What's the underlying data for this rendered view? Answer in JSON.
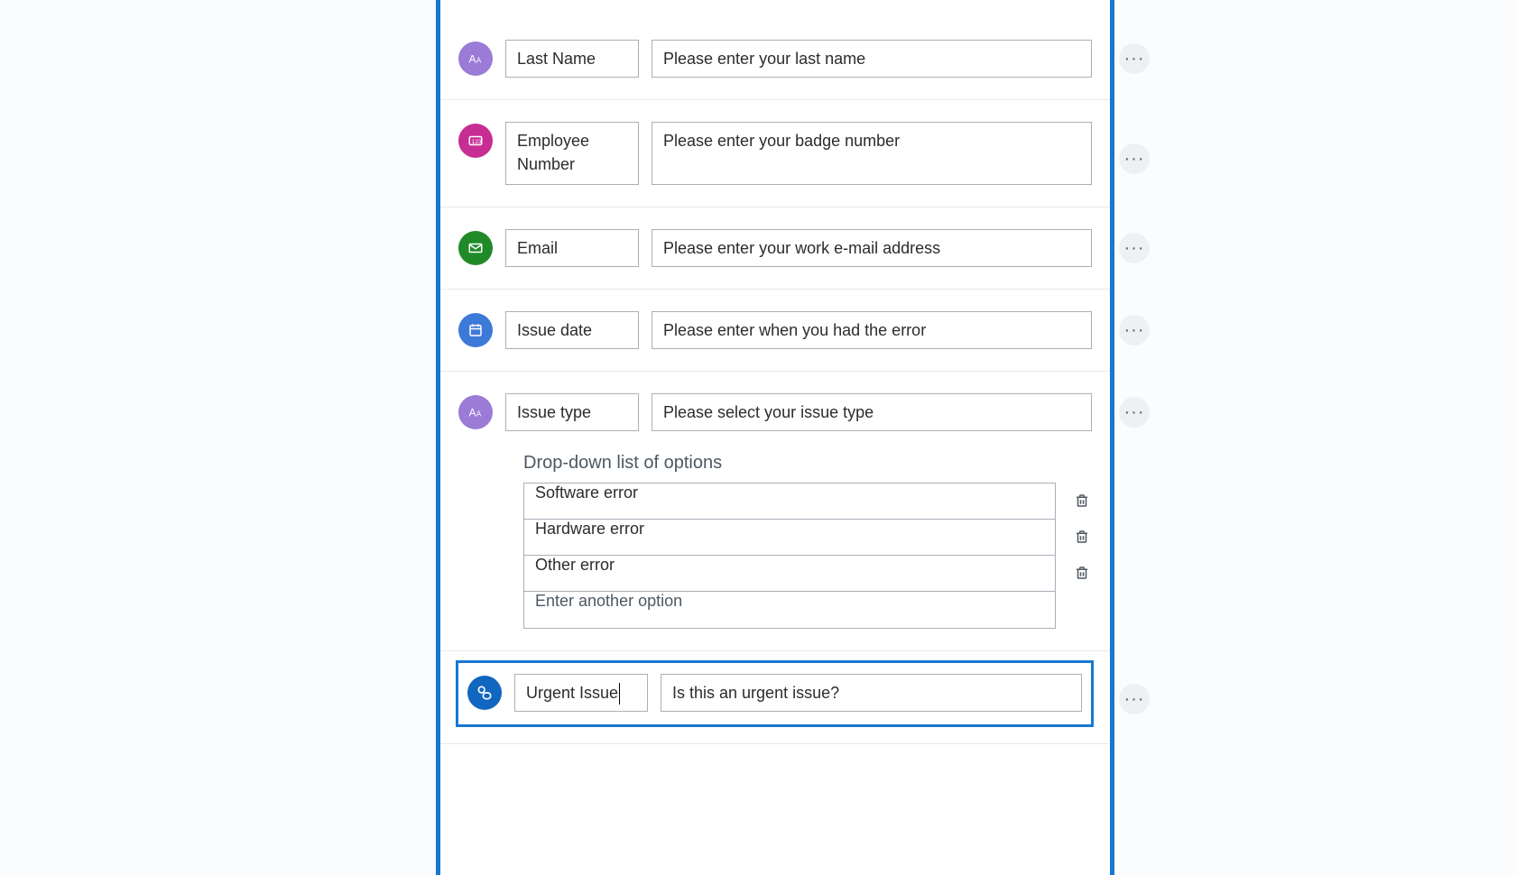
{
  "fields": {
    "lastName": {
      "label": "Last Name",
      "desc": "Please enter your last name"
    },
    "employeeNumber": {
      "label": "Employee Number",
      "desc": "Please enter your badge number"
    },
    "email": {
      "label": "Email",
      "desc": "Please enter your work e-mail address"
    },
    "issueDate": {
      "label": "Issue date",
      "desc": "Please enter when you had the error"
    },
    "issueType": {
      "label": "Issue type",
      "desc": "Please select your issue type",
      "dropdownTitle": "Drop-down list of options",
      "options": [
        "Software error",
        "Hardware error",
        "Other error"
      ],
      "addPlaceholder": "Enter another option"
    },
    "urgentIssue": {
      "label": "Urgent Issue",
      "desc": "Is this an urgent issue?"
    }
  },
  "icons": {
    "more": "ellipsis-icon",
    "text": "text-type-icon",
    "number": "number-type-icon",
    "email": "envelope-icon",
    "date": "calendar-icon",
    "toggle": "toggle-icon",
    "trash": "trash-icon"
  }
}
